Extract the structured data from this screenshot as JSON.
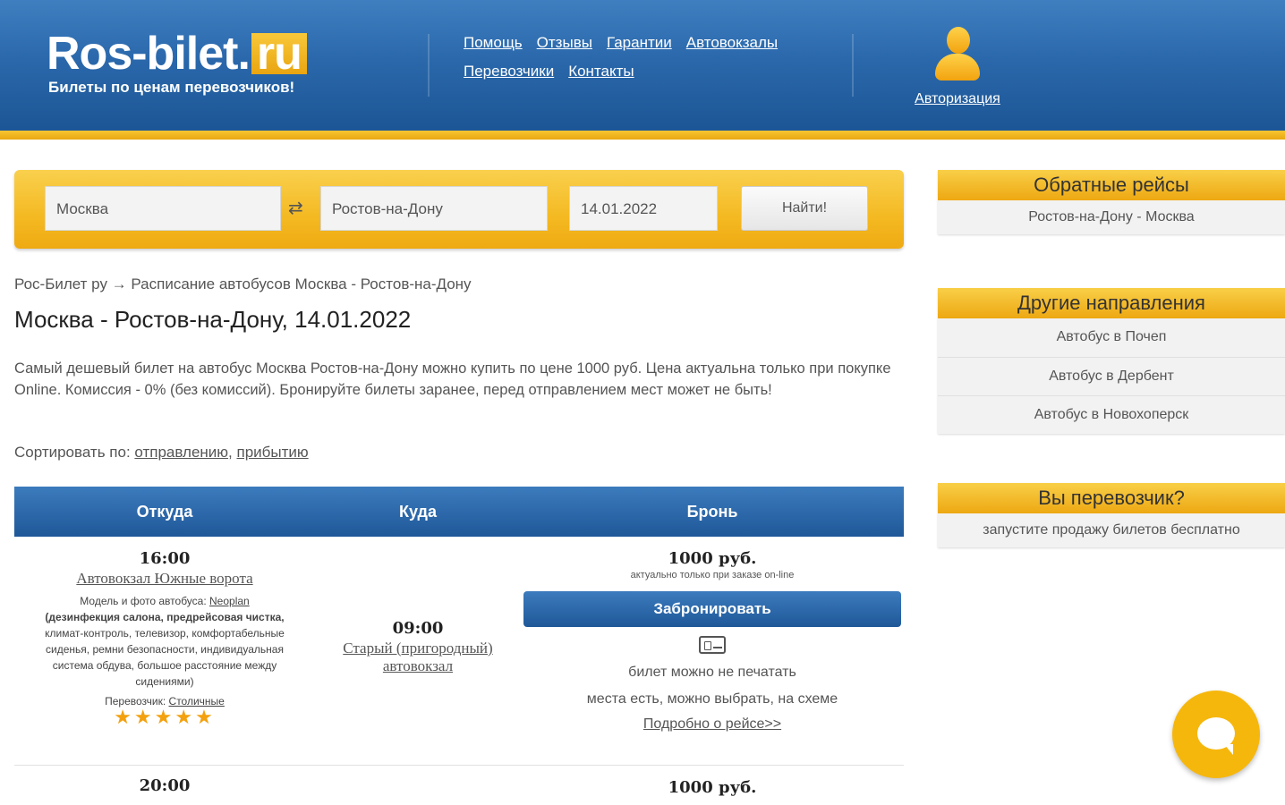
{
  "header": {
    "logo_text": "Ros-bilet.",
    "logo_ru": "ru",
    "tagline": "Билеты по ценам перевозчиков!",
    "nav_row1": [
      "Помощь",
      "Отзывы",
      "Гарантии",
      "Автовокзалы"
    ],
    "nav_row2": [
      "Перевозчики",
      "Контакты"
    ],
    "auth_label": "Авторизация"
  },
  "search": {
    "from": "Москва",
    "to": "Ростов-на-Дону",
    "date": "14.01.2022",
    "button": "Найти!"
  },
  "main": {
    "breadcrumb": "Рос-Билет ру → Расписание автобусов Москва - Ростов-на-Дону",
    "title": "Москва - Ростов-на-Дону, 14.01.2022",
    "intro": "Самый дешевый билет на автобус Москва Ростов-на-Дону можно купить по цене 1000 руб. Цена актуальна только при покупке Online. Комиссия - 0% (без комиссий). Бронируйте билеты заранее, перед отправлением мест может не быть!",
    "sort_label": "Сортировать по: ",
    "sort_departure": "отправлению",
    "sort_sep": ", ",
    "sort_arrival": "прибытию"
  },
  "table": {
    "headers": [
      "Откуда",
      "Куда",
      "Бронь"
    ],
    "rows": [
      {
        "dep_time": "16:00",
        "dep_station": "Автовокзал Южные ворота",
        "bus_model_label": "Модель и фото автобуса: ",
        "bus_model": "Neoplan",
        "bus_features_bold": "(дезинфекция салона, предрейсовая чистка,",
        "bus_features": " климат-контроль, телевизор, комфортабельные сиденья, ремни безопасности, индивидуальная система обдува, большое расстояние между сидениями)",
        "carrier_label": "Перевозчик: ",
        "carrier": "Столичные",
        "rating": 5,
        "stars": "★★★★★",
        "arr_time": "09:00",
        "arr_station": "Старый (пригородный) автовокзал",
        "price": "1000 руб.",
        "price_note": "актуально только при заказе on-line",
        "book_button": "Забронировать",
        "no_print": "билет можно не печатать",
        "seats": "места есть, можно выбрать, на схеме",
        "details_link": "Подробно о рейсе>>"
      },
      {
        "dep_time": "20:00",
        "price": "1000 руб."
      }
    ]
  },
  "sidebar": {
    "return_title": "Обратные рейсы",
    "return_item": "Ростов-на-Дону - Москва",
    "other_title": "Другие направления",
    "other_items": [
      "Автобус в Почеп",
      "Автобус в Дербент",
      "Автобус в Новохоперск"
    ],
    "carrier_title": "Вы перевозчик?",
    "carrier_text": "запустите продажу билетов бесплатно"
  },
  "colors": {
    "header_blue": "#2a68ab",
    "accent_yellow": "#f4b922",
    "table_blue": "#1f5899"
  },
  "icons": [
    "swap-icon",
    "user-icon",
    "ticket-icon",
    "chat-icon"
  ]
}
